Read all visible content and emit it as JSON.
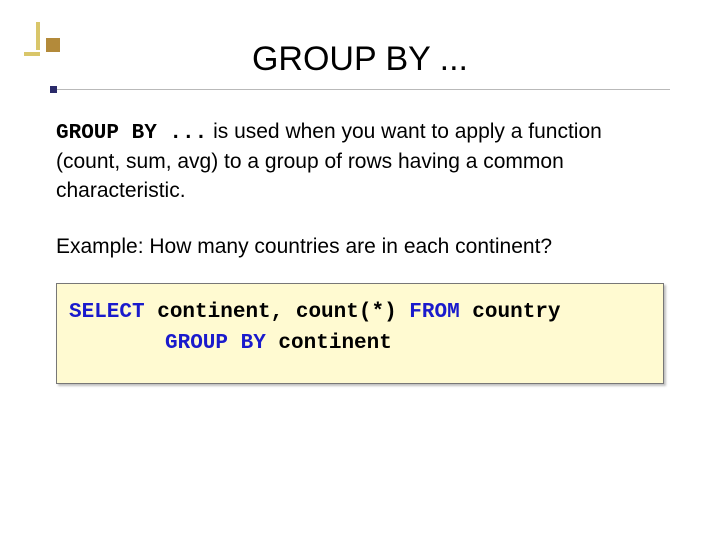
{
  "title": "GROUP BY ...",
  "para1": {
    "lead_mono": "GROUP BY ...",
    "seg1": " is used when you want to apply a function (count, sum, avg) to a group of rows having a common characteristic."
  },
  "para2": "Example: How many countries are in each continent?",
  "code": {
    "kw_select": "SELECT",
    "cols": " continent, count(*) ",
    "kw_from": "FROM",
    "tbl": " country",
    "kw_groupby": "GROUP BY",
    "col2": " continent"
  }
}
